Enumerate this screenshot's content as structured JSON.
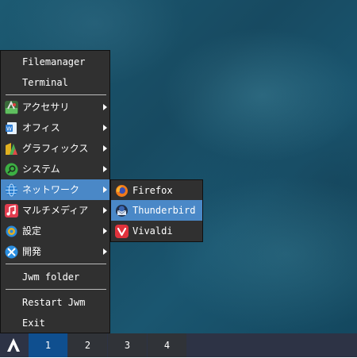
{
  "menu": {
    "items": [
      {
        "label": "Filemanager"
      },
      {
        "label": "Terminal"
      },
      {
        "label": "アクセサリ",
        "icon": "accessories-icon"
      },
      {
        "label": "オフィス",
        "icon": "office-icon"
      },
      {
        "label": "グラフィックス",
        "icon": "graphics-icon"
      },
      {
        "label": "システム",
        "icon": "system-icon"
      },
      {
        "label": "ネットワーク",
        "icon": "network-icon"
      },
      {
        "label": "マルチメディア",
        "icon": "multimedia-icon"
      },
      {
        "label": "設定",
        "icon": "settings-icon"
      },
      {
        "label": "開発",
        "icon": "development-icon"
      },
      {
        "label": "Jwm folder"
      },
      {
        "label": "Restart Jwm"
      },
      {
        "label": "Exit"
      }
    ]
  },
  "network_submenu": {
    "items": [
      {
        "label": "Firefox",
        "icon": "firefox-icon"
      },
      {
        "label": "Thunderbird",
        "icon": "thunderbird-icon"
      },
      {
        "label": "Vivaldi",
        "icon": "vivaldi-icon"
      }
    ]
  },
  "taskbar": {
    "start_icon": "arch-logo-icon",
    "workspaces": [
      "1",
      "2",
      "3",
      "4"
    ],
    "active_workspace": "1"
  },
  "colors": {
    "highlight": "#4a88c7",
    "menu_bg": "#303030",
    "taskbar_bg": "#2d3345",
    "active_workspace": "#0f4f8f"
  }
}
